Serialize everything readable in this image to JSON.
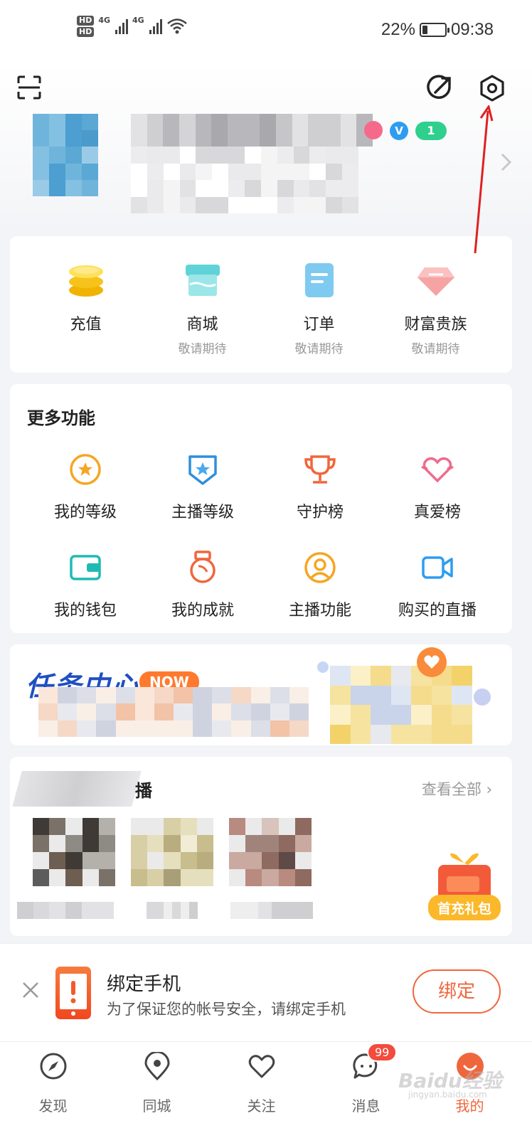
{
  "status_bar": {
    "hd1": "HD",
    "hd2": "HD",
    "net1": "4G",
    "net2": "4G",
    "battery_percent": "22%",
    "battery_level": 0.22,
    "time": "09:38"
  },
  "profile": {
    "level_badge": "1",
    "verified_badge": "V"
  },
  "quick_actions": [
    {
      "label": "充值",
      "sub": "",
      "icon": "coins-icon",
      "color": "#f7c21a"
    },
    {
      "label": "商城",
      "sub": "敬请期待",
      "icon": "store-icon",
      "color": "#76d9dd"
    },
    {
      "label": "订单",
      "sub": "敬请期待",
      "icon": "order-icon",
      "color": "#8fd1f3"
    },
    {
      "label": "财富贵族",
      "sub": "敬请期待",
      "icon": "diamond-icon",
      "color": "#f8a0a0"
    }
  ],
  "more": {
    "title": "更多功能",
    "items": [
      {
        "label": "我的等级",
        "icon": "star-badge-icon"
      },
      {
        "label": "主播等级",
        "icon": "shield-star-icon"
      },
      {
        "label": "守护榜",
        "icon": "trophy-icon"
      },
      {
        "label": "真爱榜",
        "icon": "heart-crown-icon"
      },
      {
        "label": "我的钱包",
        "icon": "wallet-icon"
      },
      {
        "label": "我的成就",
        "icon": "medal-icon"
      },
      {
        "label": "主播功能",
        "icon": "user-circle-icon"
      },
      {
        "label": "购买的直播",
        "icon": "video-icon"
      }
    ]
  },
  "task": {
    "title": "任务中心",
    "badge": "NOW"
  },
  "follow": {
    "title_tail": "播",
    "view_all": "查看全部",
    "gift_label": "首充礼包"
  },
  "bind": {
    "title": "绑定手机",
    "desc": "为了保证您的帐号安全，请绑定手机",
    "button": "绑定"
  },
  "nav": [
    {
      "label": "发现",
      "icon": "compass-icon"
    },
    {
      "label": "同城",
      "icon": "location-icon"
    },
    {
      "label": "关注",
      "icon": "heart-icon"
    },
    {
      "label": "消息",
      "icon": "chat-icon"
    },
    {
      "label": "我的",
      "icon": "profile-icon"
    }
  ],
  "message_badge": "99",
  "watermark": {
    "text": "Baidu经验",
    "sub": "jingyan.baidu.com"
  },
  "colors": {
    "accent": "#f0663c",
    "arrow": "#e02020"
  }
}
